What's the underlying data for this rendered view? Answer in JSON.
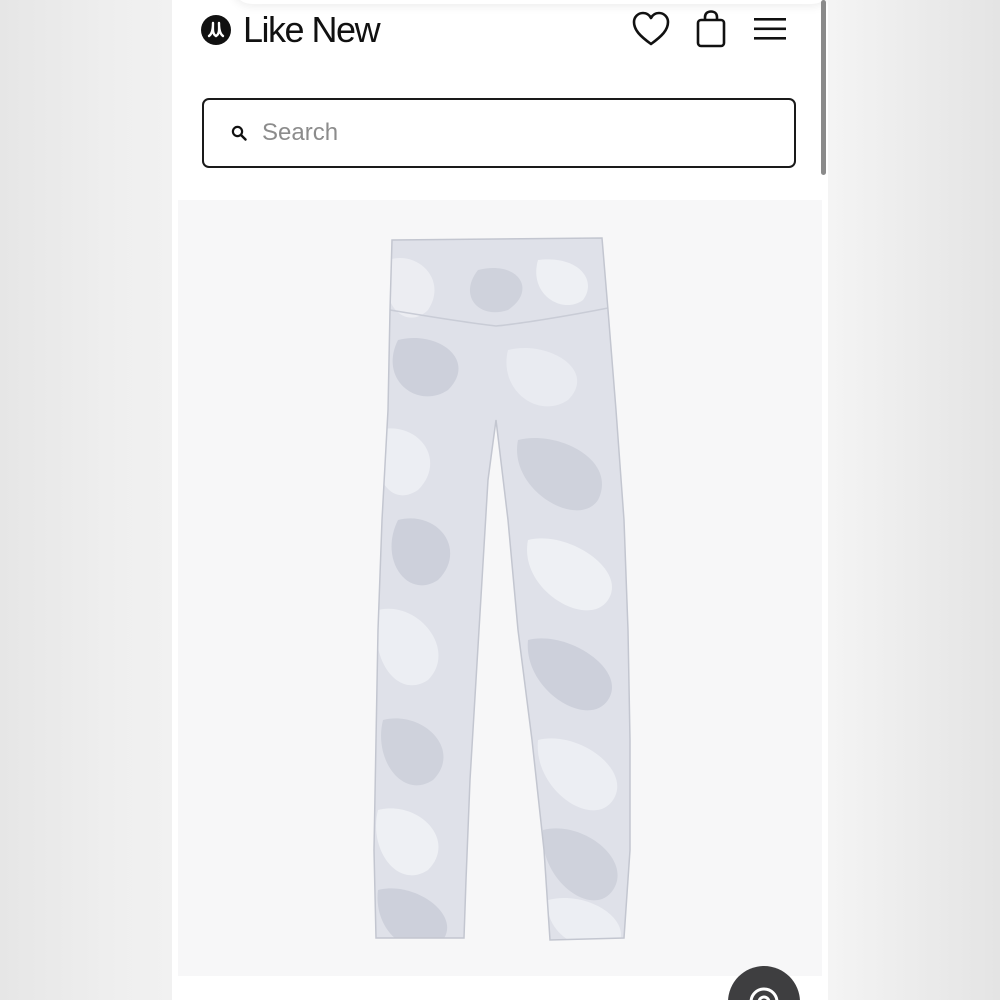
{
  "header": {
    "brand_name": "Like New",
    "logo_icon": "lululemon-logo-icon",
    "wishlist_icon": "heart-icon",
    "bag_icon": "shopping-bag-icon",
    "menu_icon": "hamburger-menu-icon"
  },
  "search": {
    "placeholder": "Search",
    "value": "",
    "icon": "search-icon"
  },
  "product": {
    "image_alt": "leggings-product-image"
  },
  "help": {
    "icon": "help-icon"
  },
  "colors": {
    "text": "#111111",
    "border": "#1a1a1a",
    "placeholder": "#8c8c8c",
    "fab": "#3e3e40",
    "product_bg": "#f7f7f8"
  }
}
